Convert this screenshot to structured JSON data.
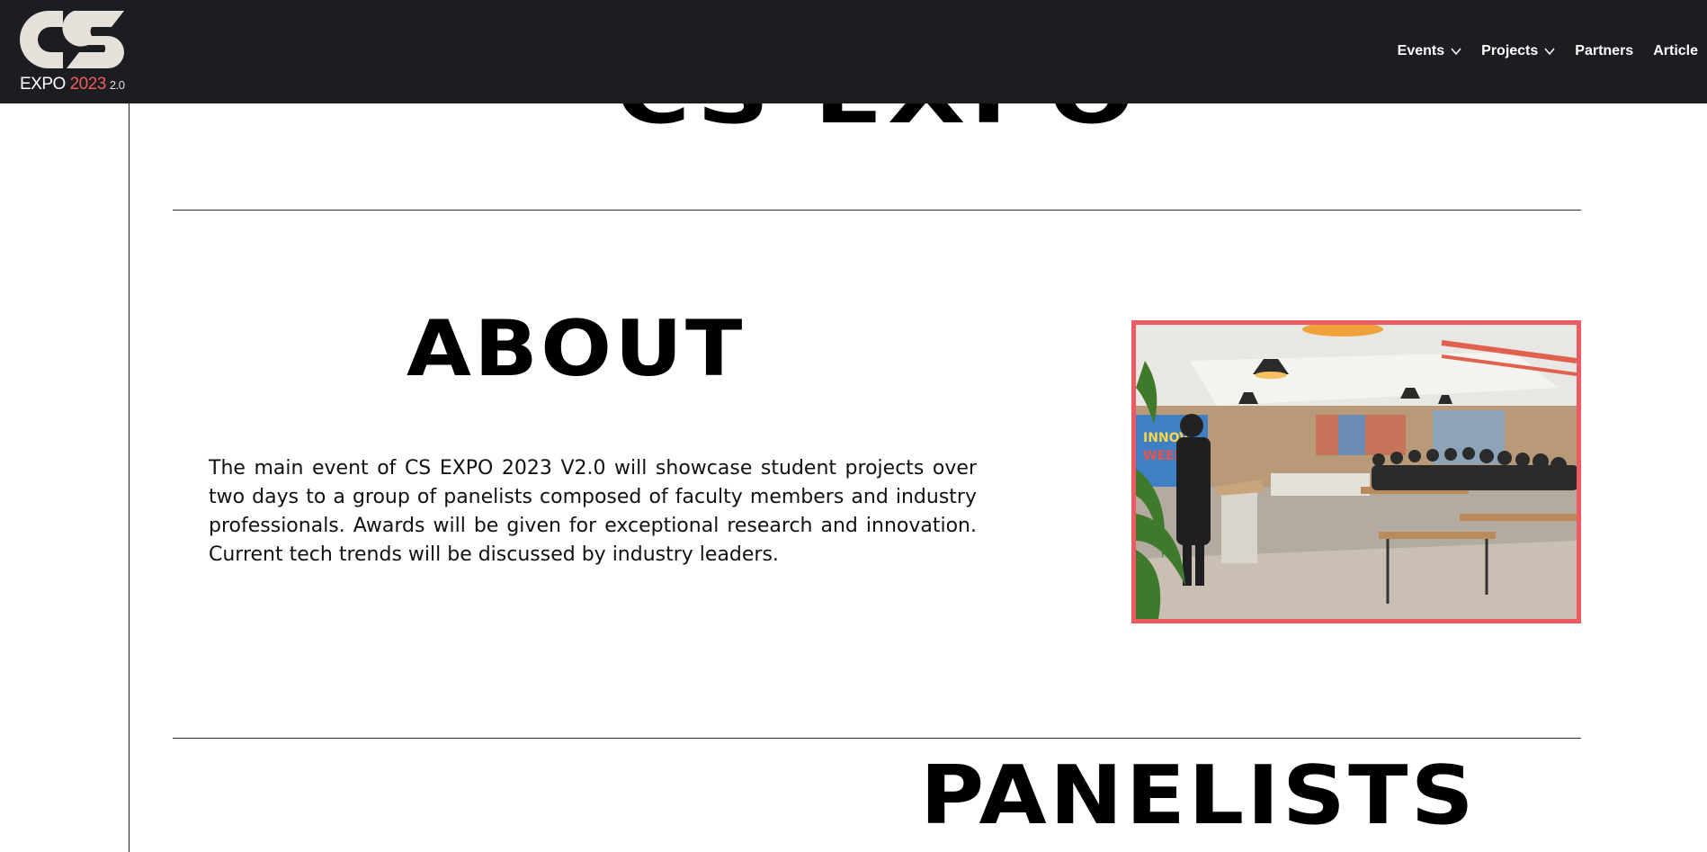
{
  "logo": {
    "expo": "EXPO",
    "year": "2023",
    "version": "2.0"
  },
  "nav": {
    "events": "Events",
    "projects": "Projects",
    "partners": "Partners",
    "article": "Article"
  },
  "hero": {
    "heading": "CS EXPO"
  },
  "about": {
    "title": "ABOUT",
    "body": "The main event of CS EXPO 2023 V2.0 will showcase student projects over two days to a group of panelists composed of faculty members and industry professionals. Awards will be given for exceptional research and innovation. Current tech trends will be discussed by industry leaders."
  },
  "panelists": {
    "title": "PANELISTS"
  },
  "colors": {
    "header_bg": "#1c1d21",
    "accent": "#ee5a62",
    "logo_shape": "#e6e0da"
  }
}
